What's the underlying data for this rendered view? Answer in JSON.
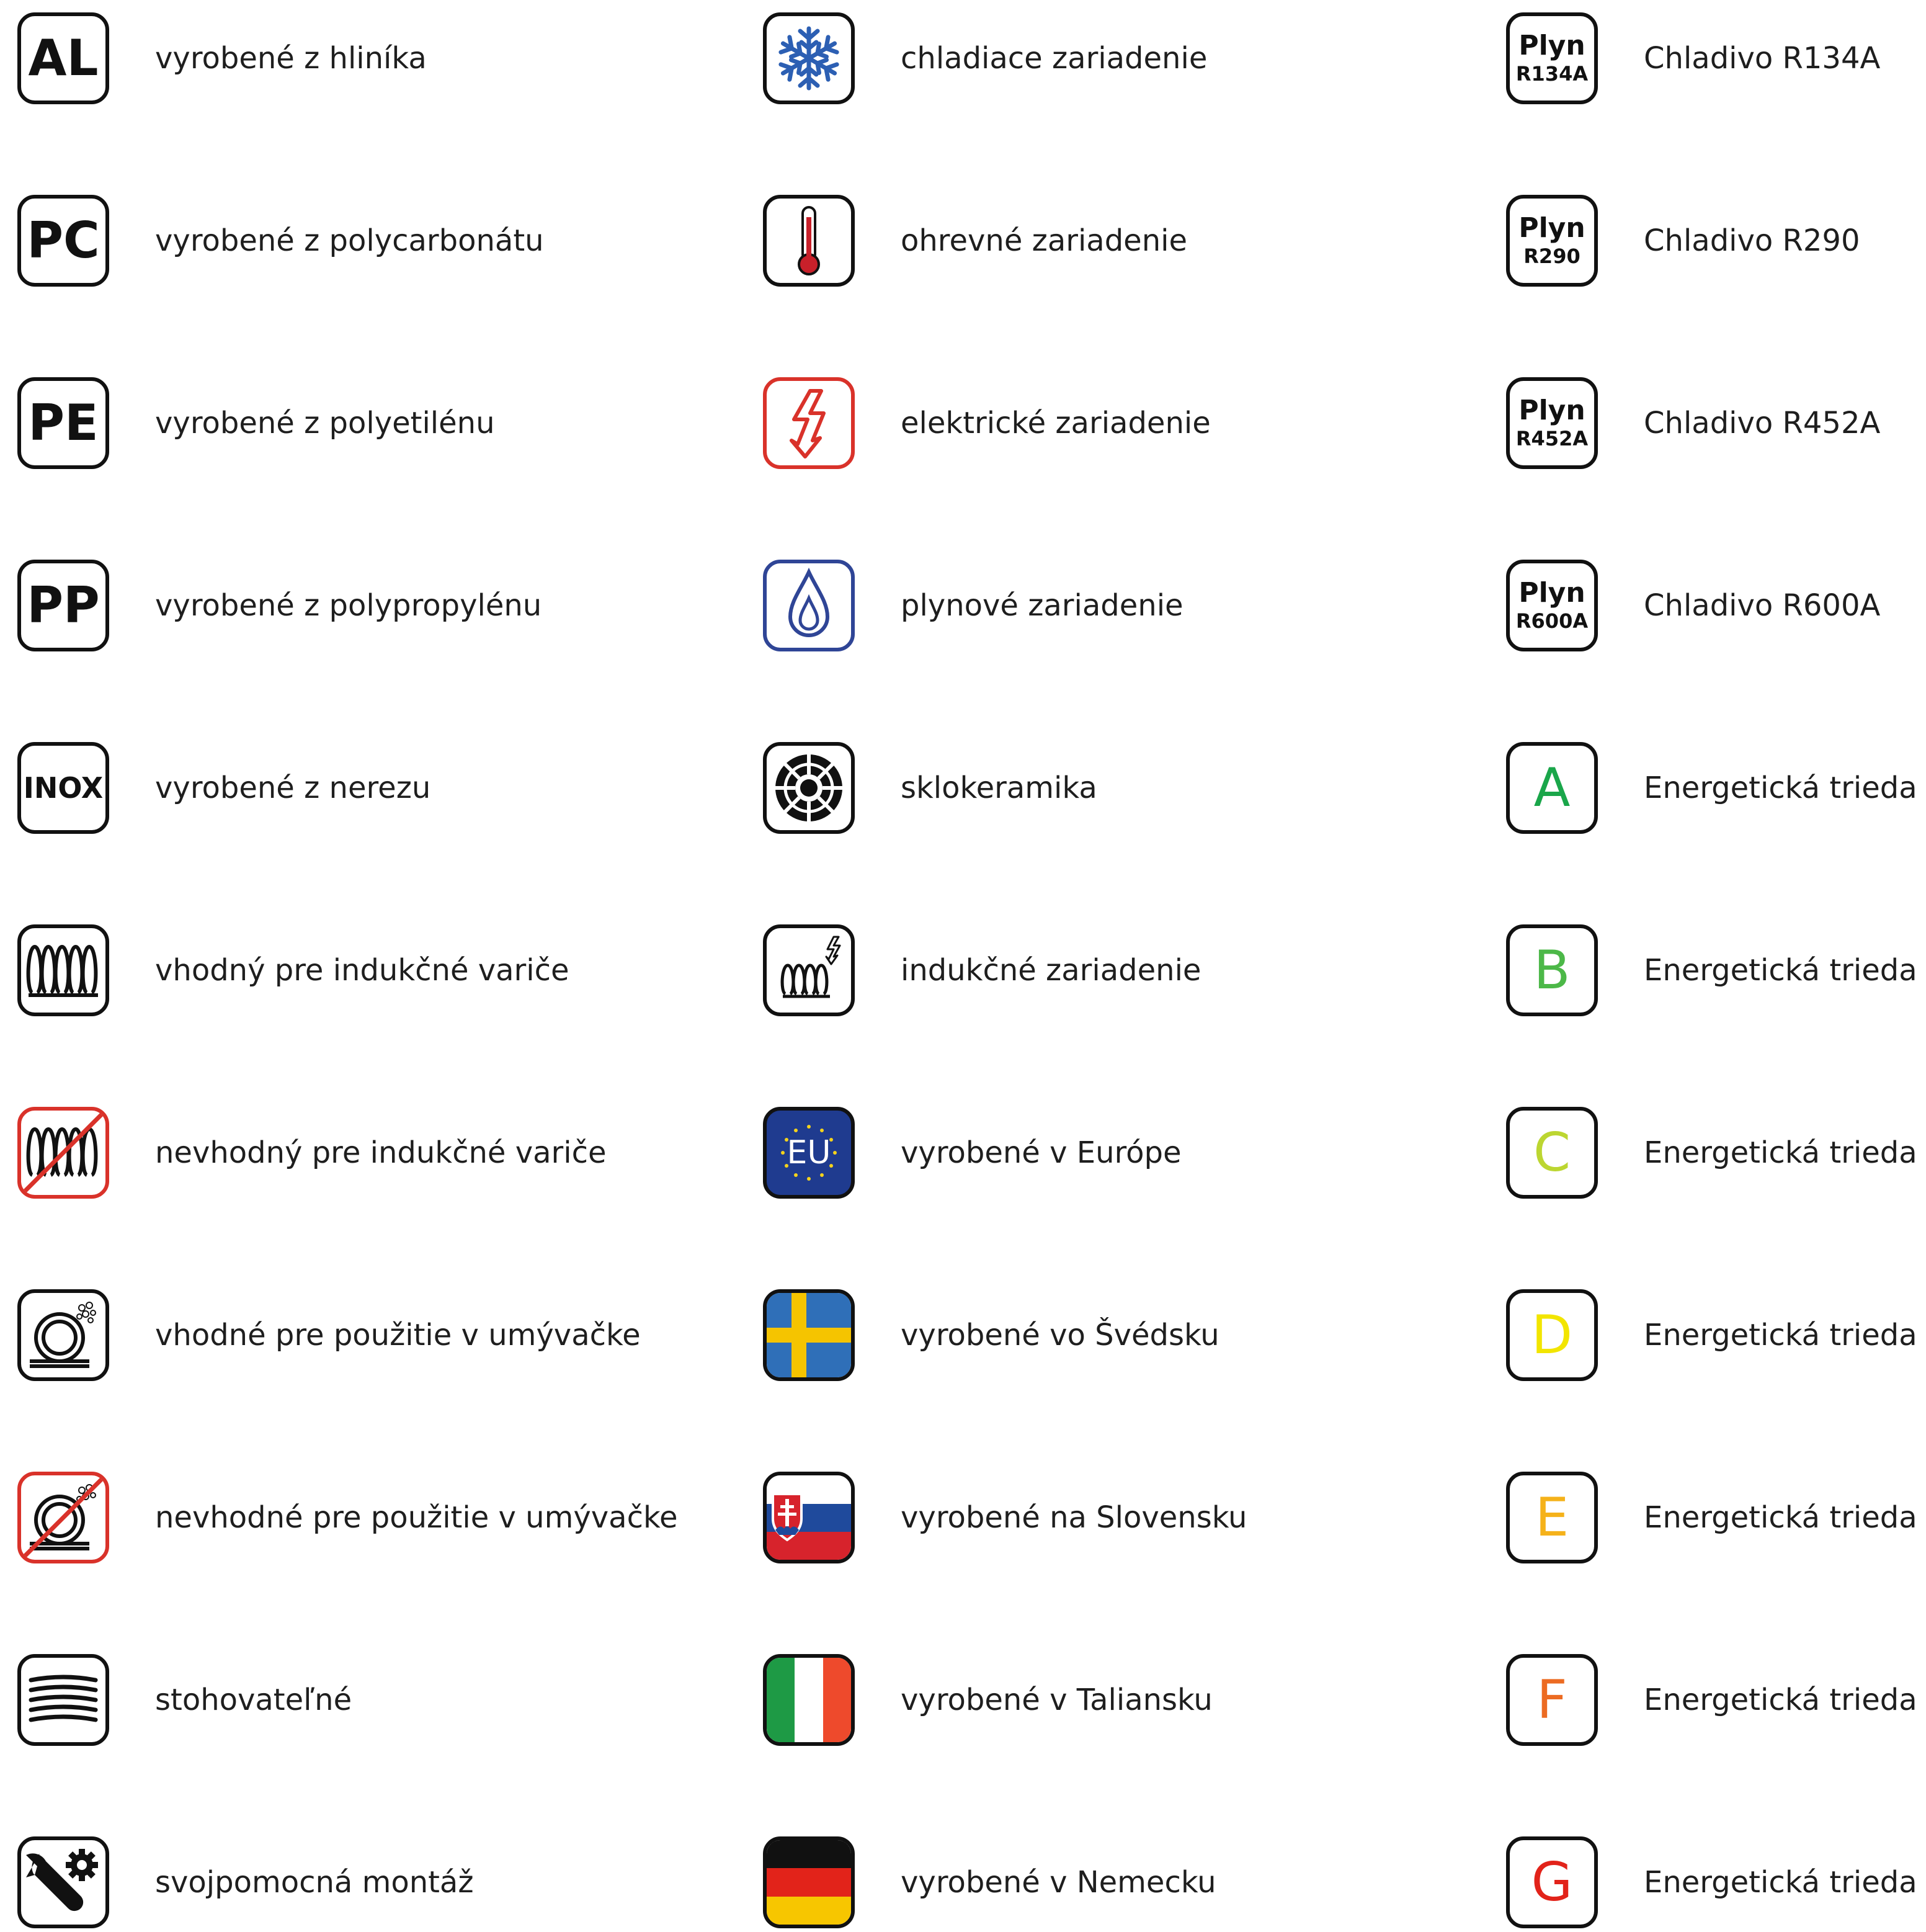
{
  "column1": [
    {
      "icon": "aluminium-icon",
      "code": "AL",
      "label": "vyrobené z hliníka"
    },
    {
      "icon": "polycarbonate-icon",
      "code": "PC",
      "label": "vyrobené z polycarbonátu"
    },
    {
      "icon": "polyethylene-icon",
      "code": "PE",
      "label": "vyrobené z polyetilénu"
    },
    {
      "icon": "polypropylene-icon",
      "code": "PP",
      "label": "vyrobené z polypropylénu"
    },
    {
      "icon": "stainless-steel-icon",
      "code": "INOX",
      "label": "vyrobené z nerezu"
    },
    {
      "icon": "induction-coil-icon",
      "label": "vhodný pre indukčné variče"
    },
    {
      "icon": "no-induction-icon",
      "label": "nevhodný pre indukčné variče"
    },
    {
      "icon": "dishwasher-safe-icon",
      "label": "vhodné pre použitie v umývačke"
    },
    {
      "icon": "not-dishwasher-safe-icon",
      "label": "nevhodné pre použitie v umývačke"
    },
    {
      "icon": "stackable-icon",
      "label": "stohovateľné"
    },
    {
      "icon": "self-assembly-icon",
      "label": "svojpomocná montáž"
    }
  ],
  "column2": [
    {
      "icon": "snowflake-icon",
      "label": "chladiace zariadenie",
      "color": "#2c5fb3"
    },
    {
      "icon": "thermometer-icon",
      "label": "ohrevné zariadenie",
      "color": "#c8202a"
    },
    {
      "icon": "lightning-icon",
      "label": "elektrické zariadenie",
      "color": "#d9322a"
    },
    {
      "icon": "gas-drop-icon",
      "label": "plynové zariadenie",
      "color": "#2f4596"
    },
    {
      "icon": "ceramic-hob-icon",
      "label": "sklokeramika"
    },
    {
      "icon": "induction-device-icon",
      "label": "indukčné zariadenie"
    },
    {
      "icon": "eu-flag-icon",
      "code": "EU",
      "label": "vyrobené v Európe",
      "color": "#1f3b8f"
    },
    {
      "icon": "sweden-flag-icon",
      "label": "vyrobené vo Švédsku"
    },
    {
      "icon": "slovakia-flag-icon",
      "label": "vyrobené na Slovensku"
    },
    {
      "icon": "italy-flag-icon",
      "label": "vyrobené v Taliansku"
    },
    {
      "icon": "germany-flag-icon",
      "label": "vyrobené v Nemecku"
    }
  ],
  "column3": [
    {
      "icon": "refrigerant-icon",
      "code_top": "Plyn",
      "code_bottom": "R134A",
      "label": "Chladivo R134A"
    },
    {
      "icon": "refrigerant-icon",
      "code_top": "Plyn",
      "code_bottom": "R290",
      "label": "Chladivo R290"
    },
    {
      "icon": "refrigerant-icon",
      "code_top": "Plyn",
      "code_bottom": "R452A",
      "label": "Chladivo R452A"
    },
    {
      "icon": "refrigerant-icon",
      "code_top": "Plyn",
      "code_bottom": "R600A",
      "label": "Chladivo R600A"
    },
    {
      "icon": "energy-class-icon",
      "code": "A",
      "label": "Energetická trieda A",
      "color": "#1aa64a"
    },
    {
      "icon": "energy-class-icon",
      "code": "B",
      "label": "Energetická trieda B",
      "color": "#4cb848"
    },
    {
      "icon": "energy-class-icon",
      "code": "C",
      "label": "Energetická trieda C",
      "color": "#bcd631"
    },
    {
      "icon": "energy-class-icon",
      "code": "D",
      "label": "Energetická trieda D",
      "color": "#f2e500"
    },
    {
      "icon": "energy-class-icon",
      "code": "E",
      "label": "Energetická trieda E",
      "color": "#f5b21a"
    },
    {
      "icon": "energy-class-icon",
      "code": "F",
      "label": "Energetická trieda F",
      "color": "#ec6b22"
    },
    {
      "icon": "energy-class-icon",
      "code": "G",
      "label": "Energetická trieda G",
      "color": "#e2231a"
    }
  ]
}
